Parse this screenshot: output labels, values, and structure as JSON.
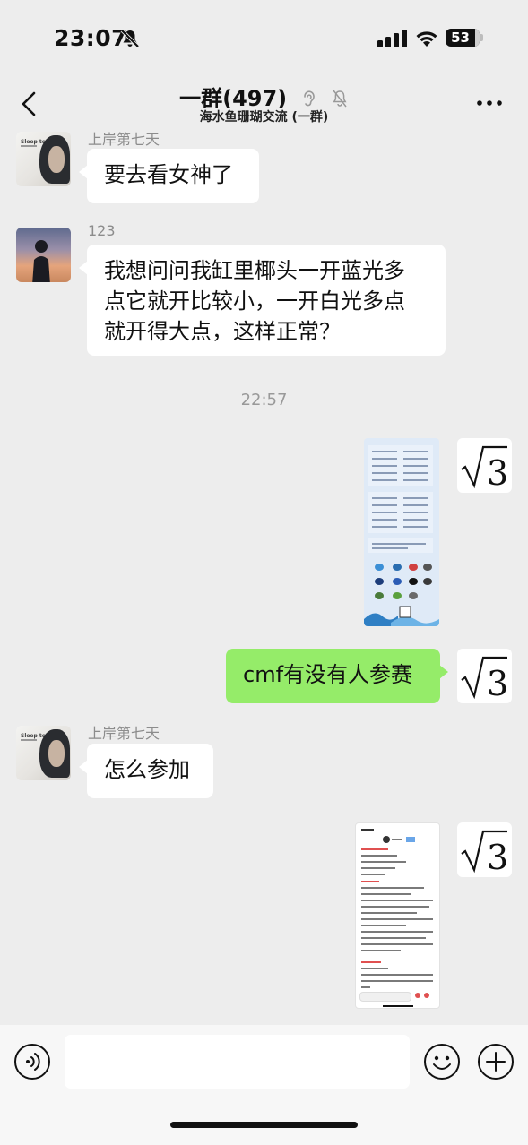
{
  "status_bar": {
    "time": "23:07",
    "battery": "53",
    "icons": [
      "bell-slash-icon",
      "signal-icon",
      "wifi-icon",
      "battery-icon"
    ]
  },
  "header": {
    "title": "一群(497)",
    "subtitle": "海水鱼珊瑚交流 (一群)",
    "icons": [
      "back-icon",
      "ear-icon",
      "bell-slash-icon",
      "more-icon"
    ]
  },
  "messages": [
    {
      "type": "text",
      "side": "left",
      "sender": "上岸第七天",
      "text": "要去看女神了"
    },
    {
      "type": "text",
      "side": "left",
      "sender": "123",
      "lines": [
        "我想问问我缸里椰头一开蓝光多",
        "点它就开比较小，一开白光多点",
        "就开得大点，这样正常？"
      ]
    },
    {
      "type": "timestamp",
      "text": "22:57"
    },
    {
      "type": "image",
      "side": "right",
      "description_icon": "poster-image"
    },
    {
      "type": "text",
      "side": "right",
      "text": "cmf有没有人参赛"
    },
    {
      "type": "text",
      "side": "left",
      "sender": "上岸第七天",
      "text": "怎么参加"
    },
    {
      "type": "image",
      "side": "right",
      "description_icon": "screenshot-image"
    }
  ],
  "colors": {
    "background": "#ededed",
    "bubble_self": "#95ec69",
    "bubble_other": "#ffffff",
    "input_bar": "#f7f7f7"
  }
}
